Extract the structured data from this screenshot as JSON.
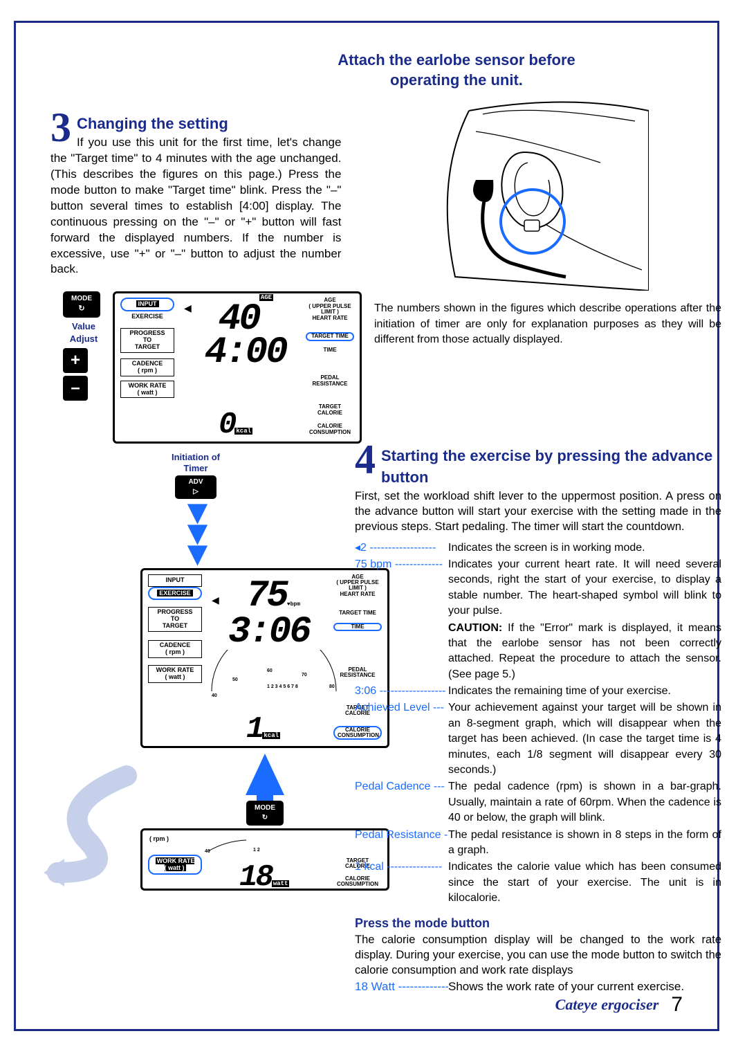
{
  "header": {
    "line1": "Attach the earlobe sensor before",
    "line2": "operating the unit."
  },
  "section3": {
    "num": "3",
    "title": "Changing the setting",
    "body": "If you use this unit for the first time, let's change the \"Target time\" to 4 minutes with the age unchanged. (This describes the figures on this page.) Press the mode button to make \"Target time\" blink. Press the \"–\" button several times to establish [4:00] display. The continuous pressing on the \"–\" or \"+\" button will fast forward the displayed numbers. If the number is excessive, use \"+\" or \"–\" button to adjust the number back."
  },
  "footnote": {
    "ast": "*",
    "text": "The numbers shown in the figures which describe operations after the initiation of timer are only for explanation purposes as they will be different from those actually displayed."
  },
  "panel1": {
    "mode_btn": "MODE",
    "value_adjust": "Value\nAdjust",
    "plus": "+",
    "minus": "–",
    "input": "INPUT",
    "exercise": "EXERCISE",
    "progress": "PROGRESS\nTO\nTARGET",
    "cadence": "CADENCE\n( rpm )",
    "workrate": "WORK RATE\n( watt )",
    "age_val": "40",
    "age_tag": "AGE",
    "time_val": "4:00",
    "right_age": "AGE\n( UPPER PULSE LIMIT )\nHEART RATE",
    "right_target_time": "TARGET TIME",
    "right_time": "TIME",
    "right_pedal": "PEDAL\nRESISTANCE",
    "right_target_cal": "TARGET\nCALORIE",
    "right_cal": "CALORIE\nCONSUMPTION",
    "kcal": "0",
    "kcal_unit": "kcal"
  },
  "adv": {
    "label1": "Initiation of",
    "label2": "Timer",
    "btn": "ADV"
  },
  "panel2": {
    "input": "INPUT",
    "exercise": "EXERCISE",
    "progress": "PROGRESS\nTO\nTARGET",
    "cadence": "CADENCE\n( rpm )",
    "workrate": "WORK RATE\n( watt )",
    "bpm_val": "75",
    "bpm_unit": "bpm",
    "time_val": "3:06",
    "right_age": "AGE\n( UPPER PULSE LIMIT )\nHEART RATE",
    "right_target_time": "TARGET TIME",
    "right_time": "TIME",
    "right_pedal": "PEDAL\nRESISTANCE",
    "right_target_cal": "TARGET\nCALORIE",
    "right_cal": "CALORIE\nCONSUMPTION",
    "kcal": "1",
    "kcal_unit": "kcal",
    "rpm_ticks": "40   50   60   70   80",
    "res_ticks": "1 2 3 4 5 6 7 8"
  },
  "mode_between": "MODE",
  "panel3": {
    "rpm": "( rpm )",
    "workrate": "WORK RATE\n( watt )",
    "watt_val": "18",
    "watt_unit": "watt",
    "rpm_ticks": "40        1 2",
    "right_target_cal": "TARGET\nCALORIE",
    "right_cal": "CALORIE\nCONSUMPTION"
  },
  "section4": {
    "num": "4",
    "title": "Starting the exercise by pressing the advance button",
    "body": "First, set the workload shift lever to the uppermost position. A press on the advance button will start your exercise with the setting made in the previous steps. Start pedaling. The timer will start the countdown.",
    "defs": [
      {
        "key": "◂2",
        "dash": " ------------------",
        "val": "Indicates the screen is in working mode."
      },
      {
        "key": "75 bpm",
        "dash": " -------------",
        "val": "Indicates your current heart rate. It will need several seconds, right the start of your exercise, to display a stable number. The heart-shaped symbol will blink to your pulse."
      },
      {
        "key": "",
        "dash": "",
        "val": "CAUTION: If the \"Error\" mark is displayed, it means that the earlobe sensor has not been correctly attached. Repeat the procedure to attach the sensor. (See page 5.)",
        "caution": true
      },
      {
        "key": "3:06",
        "dash": " ------------------",
        "val": "Indicates the remaining time of your exercise."
      },
      {
        "key": "Achieved Level",
        "dash": " ---",
        "val": "Your achievement against your target will be shown in an 8-segment graph, which will disappear when the target has been achieved. (In case the target time is 4 minutes, each 1/8 segment will disappear every 30 seconds.)"
      },
      {
        "key": "Pedal Cadence",
        "dash": " ---",
        "val": "The pedal cadence (rpm) is shown in a bar-graph. Usually, maintain a rate of 60rpm. When the cadence is 40 or below, the graph will blink."
      },
      {
        "key": "Pedal Resistance",
        "dash": " --",
        "val": "The pedal resistance is shown in 8 steps in the form of a graph."
      },
      {
        "key": "1 kcal",
        "dash": " ---------------",
        "val": "Indicates the calorie value which has been consumed since the start of your exercise. The unit is in kilocalorie."
      }
    ],
    "press_mode_title": "Press the mode button",
    "press_mode_body": "The calorie consumption display will be changed to the work rate display. During your exercise, you can use the mode button to switch the calorie consumption and work rate displays",
    "watt_key": "18 Watt",
    "watt_dash": " -------------",
    "watt_val": "Shows the work rate of your current exercise."
  },
  "footer": {
    "brand": "Cateye ergociser",
    "page": "7"
  }
}
